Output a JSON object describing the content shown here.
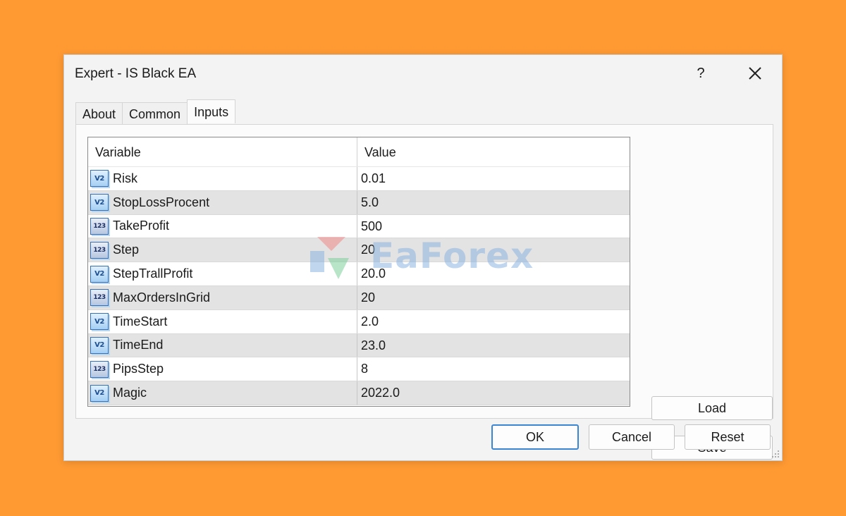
{
  "window": {
    "title": "Expert - IS Black EA",
    "help_label": "?"
  },
  "tabs": [
    {
      "label": "About",
      "active": false
    },
    {
      "label": "Common",
      "active": false
    },
    {
      "label": "Inputs",
      "active": true
    }
  ],
  "grid": {
    "headers": {
      "variable": "Variable",
      "value": "Value"
    },
    "rows": [
      {
        "icon": "double-type-icon",
        "icon_text": "V2",
        "variable": "Risk",
        "value": "0.01"
      },
      {
        "icon": "double-type-icon",
        "icon_text": "V2",
        "variable": "StopLossProcent",
        "value": "5.0"
      },
      {
        "icon": "integer-type-icon",
        "icon_text": "123",
        "variable": "TakeProfit",
        "value": "500"
      },
      {
        "icon": "integer-type-icon",
        "icon_text": "123",
        "variable": "Step",
        "value": "20"
      },
      {
        "icon": "double-type-icon",
        "icon_text": "V2",
        "variable": "StepTrallProfit",
        "value": "20.0"
      },
      {
        "icon": "integer-type-icon",
        "icon_text": "123",
        "variable": "MaxOrdersInGrid",
        "value": "20"
      },
      {
        "icon": "double-type-icon",
        "icon_text": "V2",
        "variable": "TimeStart",
        "value": "2.0"
      },
      {
        "icon": "double-type-icon",
        "icon_text": "V2",
        "variable": "TimeEnd",
        "value": "23.0"
      },
      {
        "icon": "integer-type-icon",
        "icon_text": "123",
        "variable": "PipsStep",
        "value": "8"
      },
      {
        "icon": "double-type-icon",
        "icon_text": "V2",
        "variable": "Magic",
        "value": "2022.0"
      }
    ]
  },
  "side_buttons": {
    "load": "Load",
    "save": "Save"
  },
  "footer_buttons": {
    "ok": "OK",
    "cancel": "Cancel",
    "reset": "Reset"
  },
  "watermark": {
    "text": "EaForex"
  },
  "colors": {
    "background": "#FF9A33",
    "ok_border": "#3A86D4",
    "alt_row": "#E3E3E3"
  }
}
